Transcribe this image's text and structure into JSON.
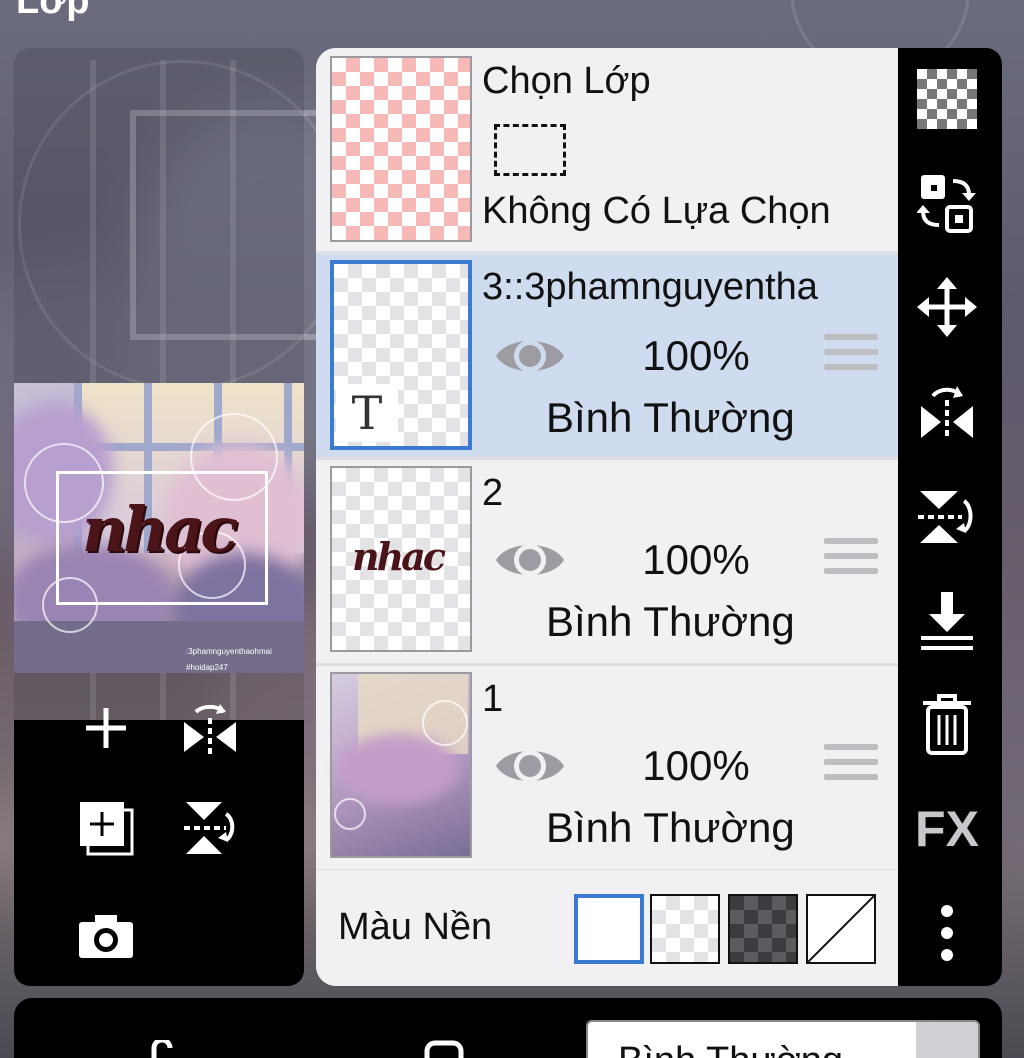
{
  "header": {
    "title": "Lớp"
  },
  "selection_row": {
    "title": "Chọn Lớp",
    "status": "Không Có Lựa Chọn"
  },
  "layers": [
    {
      "name": "3::3phamnguyentha",
      "opacity": "100%",
      "blend": "Bình Thường",
      "type_badge": "T",
      "selected": true
    },
    {
      "name": "2",
      "opacity": "100%",
      "blend": "Bình Thường",
      "selected": false
    },
    {
      "name": "1",
      "opacity": "100%",
      "blend": "Bình Thường",
      "selected": false
    }
  ],
  "background_row": {
    "label": "Màu Nền",
    "options": [
      "white",
      "transparent-light",
      "transparent-dark",
      "none"
    ],
    "selected": "white"
  },
  "preview": {
    "overlay_text": "nhac",
    "caption_1": ":3phamnguyenthaohmai",
    "caption_2": "#hoidap247"
  },
  "layer2_thumb_text": "nhac",
  "sidebar": {
    "icons": [
      "checker-icon",
      "swap-layers-icon",
      "move-icon",
      "flip-horizontal-icon",
      "flip-vertical-icon",
      "merge-down-icon",
      "trash-icon",
      "fx-icon",
      "more-icon"
    ],
    "fx_label": "FX"
  },
  "left_tools": {
    "icons": [
      "add-icon",
      "flip-horizontal-icon",
      "add-layer-icon",
      "flip-vertical-icon",
      "camera-icon"
    ]
  },
  "bottom_bar": {
    "blend_value": "Bình Thường"
  },
  "colors": {
    "accent": "#3a7ad0",
    "selected_row": "#cfdcef",
    "panel": "#f1f1f3",
    "sidebar": "#000000"
  }
}
